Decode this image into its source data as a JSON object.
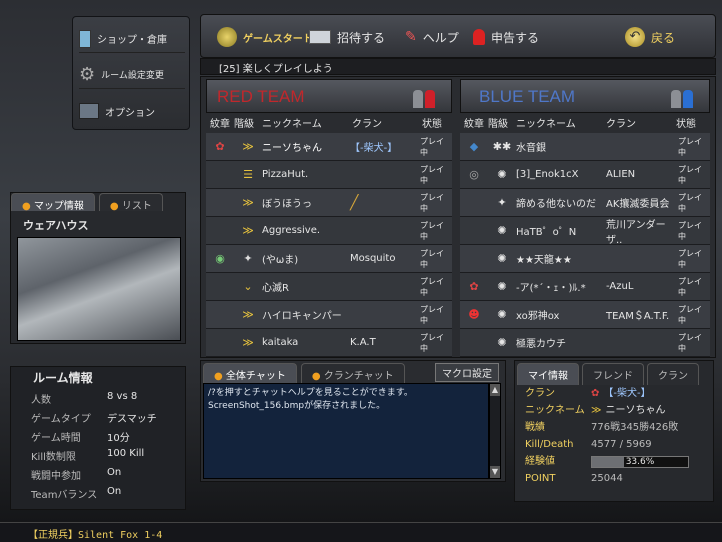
{
  "left_menu": {
    "shop": "ショップ・倉庫",
    "room_settings": "ルーム設定変更",
    "options": "オプション"
  },
  "toolbar": {
    "start": "ゲームスタート",
    "invite": "招待する",
    "help": "ヘルプ",
    "report": "申告する",
    "back": "戻る"
  },
  "room_title": "[25] 楽しくプレイしよう",
  "teams": {
    "red": {
      "name": "RED TEAM",
      "headers": [
        "紋章",
        "階級",
        "ニックネーム",
        "クラン",
        "状態"
      ],
      "players": [
        {
          "name": "ニーソちゃん",
          "clan": "【-柴犬-】",
          "status": "プレイ中"
        },
        {
          "name": "PizzaHut.",
          "clan": "",
          "status": "プレイ中"
        },
        {
          "name": "ぼうほうっ",
          "clan": "",
          "status": "プレイ中"
        },
        {
          "name": "Aggressive.",
          "clan": "",
          "status": "プレイ中"
        },
        {
          "name": "(やωま)",
          "clan": "Mosquito",
          "status": "プレイ中"
        },
        {
          "name": "心滅R",
          "clan": "",
          "status": "プレイ中"
        },
        {
          "name": "ハイロキャンパー",
          "clan": "",
          "status": "プレイ中"
        },
        {
          "name": "kaitaka",
          "clan": "K.A.T",
          "status": "プレイ中"
        }
      ]
    },
    "blue": {
      "name": "BLUE TEAM",
      "headers": [
        "紋章",
        "階級",
        "ニックネーム",
        "クラン",
        "状態"
      ],
      "players": [
        {
          "name": "水音銀",
          "clan": "",
          "status": "プレイ中"
        },
        {
          "name": "[3]_Enok1cX",
          "clan": "ALIEN",
          "status": "プレイ中"
        },
        {
          "name": "諦める他ないのだ",
          "clan": "AK攘滅委員会",
          "status": "プレイ中"
        },
        {
          "name": "HaTB゜o゜N",
          "clan": "荒川アンダーザ..",
          "status": "プレイ中"
        },
        {
          "name": "★★天龍★★",
          "clan": "",
          "status": "プレイ中"
        },
        {
          "name": "-ア(*´・ｪ・)ﾙ.*",
          "clan": "-AzuL",
          "status": "プレイ中"
        },
        {
          "name": "xo邪神ox",
          "clan": "TEAM＄A.T.F.",
          "status": "プレイ中"
        },
        {
          "name": "極悪カウチ",
          "clan": "",
          "status": "プレイ中"
        }
      ]
    }
  },
  "map_tabs": {
    "info": "マップ情報",
    "list": "リスト"
  },
  "map_name": "ウェアハウス",
  "room_info": {
    "title": "ルーム情報",
    "rows": [
      {
        "label": "人数",
        "value": "8 vs 8"
      },
      {
        "label": "ゲームタイプ",
        "value": "デスマッチ"
      },
      {
        "label": "ゲーム時間",
        "value": "10分"
      },
      {
        "label": "Kill数制限",
        "value": "100 Kill"
      },
      {
        "label": "戦闘中参加",
        "value": "On"
      },
      {
        "label": "Teamバランス",
        "value": "On"
      }
    ]
  },
  "chat": {
    "tab_all": "全体チャット",
    "tab_clan": "クランチャット",
    "macro": "マクロ設定",
    "lines": [
      "/?を押すとチャットヘルプを見ることができます。",
      "ScreenShot_156.bmpが保存されました。"
    ]
  },
  "myinfo": {
    "tabs": [
      "マイ情報",
      "フレンド",
      "クラン"
    ],
    "clan_label": "クラン",
    "clan": "【-柴犬-】",
    "nick_label": "ニックネーム",
    "nick": "ニーソちゃん",
    "record_label": "戦績",
    "record": "776戦345勝426敗",
    "kd_label": "Kill/Death",
    "kd": "4577 / 5969",
    "exp_label": "経験値",
    "exp": "33.6%",
    "exp_fraction": 0.336,
    "point_label": "POINT",
    "point": "25044"
  },
  "status_bar": "【正規兵】Silent Fox 1-4"
}
